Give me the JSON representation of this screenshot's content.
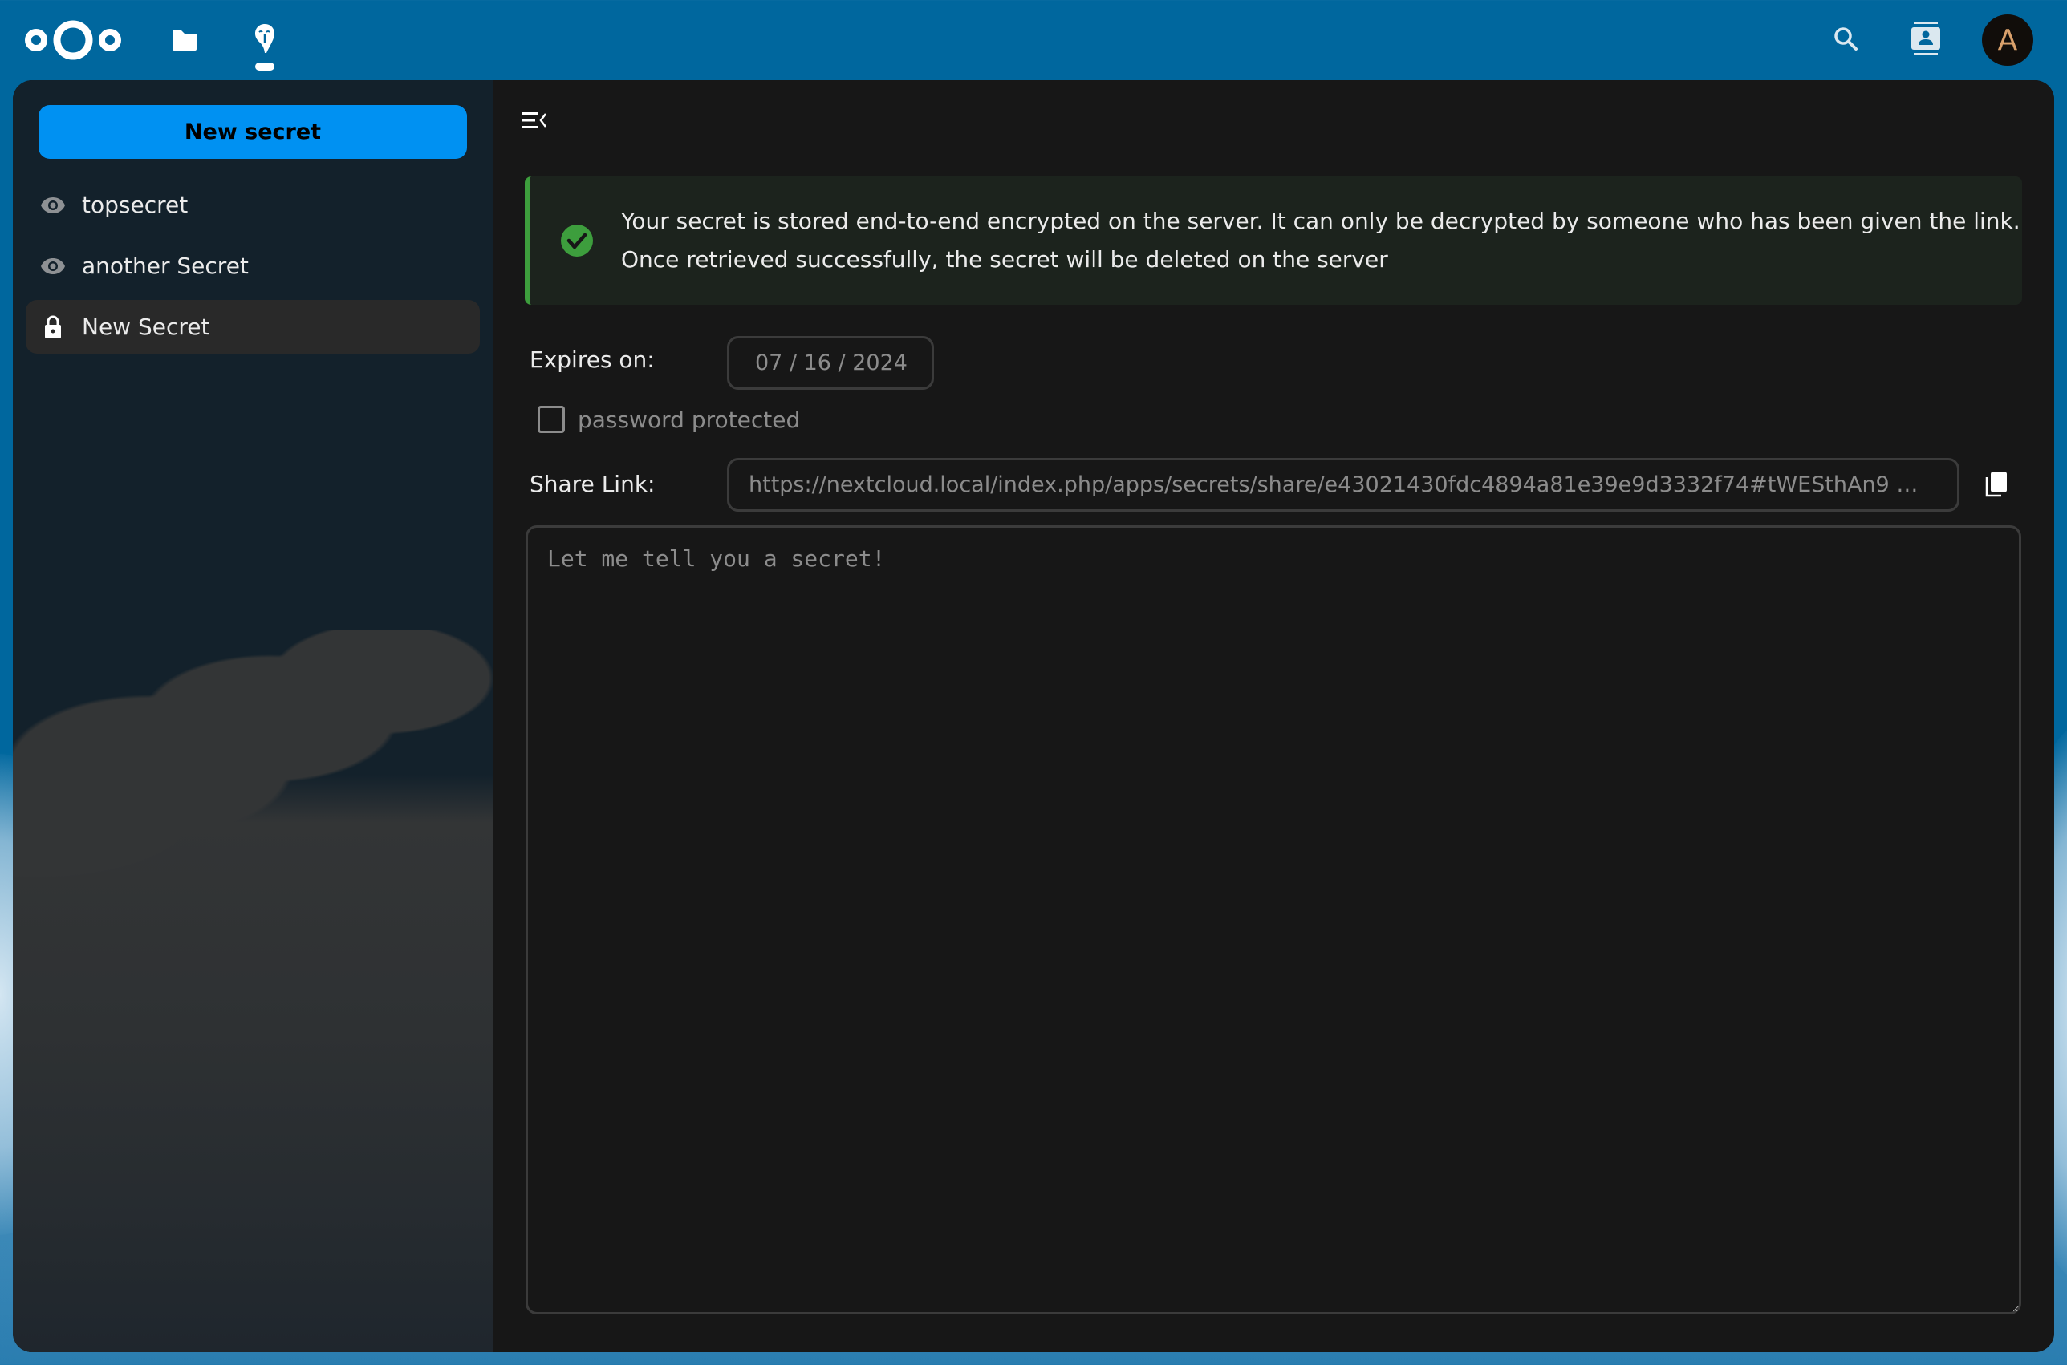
{
  "header": {
    "logo": "nextcloud-logo",
    "apps": [
      {
        "name": "Files",
        "icon": "folder-icon",
        "active": false
      },
      {
        "name": "Secrets",
        "icon": "secrets-icon",
        "active": true
      }
    ],
    "search_icon": "search-icon",
    "contacts_icon": "contacts-icon",
    "avatar_initial": "A"
  },
  "sidebar": {
    "new_button_label": "New secret",
    "items": [
      {
        "label": "topsecret",
        "icon": "eye-icon",
        "active": false
      },
      {
        "label": "another Secret",
        "icon": "eye-icon",
        "active": false
      },
      {
        "label": "New Secret",
        "icon": "lock-icon",
        "active": true
      }
    ]
  },
  "main": {
    "notice": {
      "icon": "check-circle-icon",
      "line1": "Your secret is stored end-to-end encrypted on the server. It can only be decrypted by someone who has been given the link.",
      "line2": "Once retrieved successfully, the secret will be deleted on the server"
    },
    "expires_label": "Expires on:",
    "expires_value": "07 / 16 / 2024",
    "password_protected_label": "password protected",
    "password_protected_checked": false,
    "share_link_label": "Share Link:",
    "share_link_value": "https://nextcloud.local/index.php/apps/secrets/share/e43021430fdc4894a81e39e9d3332f74#tWESthAn9 …",
    "secret_placeholder": "Let me tell you a secret!"
  },
  "colors": {
    "header_bg": "#00679e",
    "primary": "#0091f2",
    "success": "#3d9e3d",
    "main_bg": "#171717",
    "sidebar_bg": "#13212b"
  }
}
